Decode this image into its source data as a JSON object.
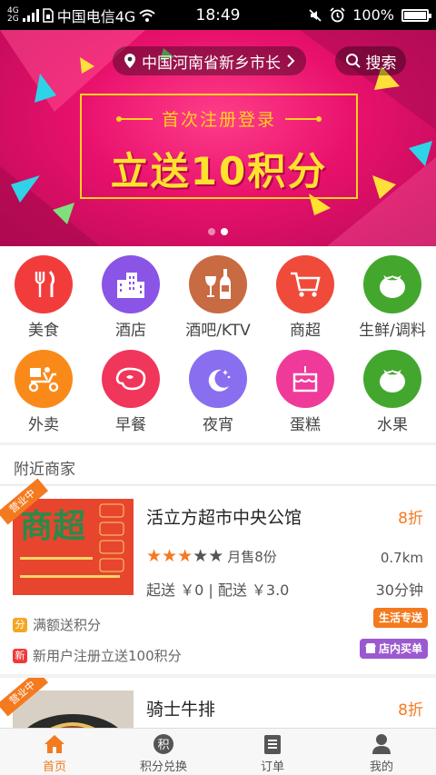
{
  "status_bar": {
    "carrier": "中国电信4G",
    "net_top": "4G",
    "net_bottom": "2G",
    "time": "18:49",
    "battery": "100%"
  },
  "banner": {
    "location": "中国河南省新乡市长",
    "search_label": "搜索",
    "promo_subtitle": "首次注册登录",
    "promo_title": "立送10积分",
    "slides_total": 2,
    "active_slide": 2
  },
  "categories": [
    {
      "label": "美食",
      "icon": "fork-knife-icon",
      "color": "#f23c3c"
    },
    {
      "label": "酒店",
      "icon": "hotel-building-icon",
      "color": "#8a54e6"
    },
    {
      "label": "酒吧/KTV",
      "icon": "wine-bottle-icon",
      "color": "#c86a42"
    },
    {
      "label": "商超",
      "icon": "shopping-cart-icon",
      "color": "#f04a3a"
    },
    {
      "label": "生鲜/调料",
      "icon": "tomato-icon",
      "color": "#43a72e"
    },
    {
      "label": "外卖",
      "icon": "delivery-scooter-icon",
      "color": "#f98a1a"
    },
    {
      "label": "早餐",
      "icon": "steak-icon",
      "color": "#f0365a"
    },
    {
      "label": "夜宵",
      "icon": "moon-icon",
      "color": "#8a6ef0"
    },
    {
      "label": "蛋糕",
      "icon": "cake-icon",
      "color": "#f03a9a"
    },
    {
      "label": "水果",
      "icon": "tomato-icon",
      "color": "#43a72e"
    }
  ],
  "nearby": {
    "title": "附近商家",
    "shops": [
      {
        "ribbon": "营业中",
        "thumb_title": "商超",
        "name": "活立方超市中央公馆",
        "discount": "8折",
        "rating": 3,
        "rating_max": 5,
        "sales": "月售8份",
        "distance": "0.7km",
        "fees": "起送 ￥0 | 配送 ￥3.0",
        "delivery_time": "30分钟",
        "promo1_badge": "分",
        "promo1": "满额送积分",
        "promo2_badge": "新",
        "promo2": "新用户注册立送100积分",
        "tag1": "生活专送",
        "tag2": "店内买单"
      },
      {
        "ribbon": "营业中",
        "name": "骑士牛排",
        "discount": "8折"
      }
    ]
  },
  "tabbar": {
    "tabs": [
      {
        "label": "首页",
        "icon": "home-icon"
      },
      {
        "label": "积分兑换",
        "icon": "points-icon"
      },
      {
        "label": "订单",
        "icon": "order-list-icon"
      },
      {
        "label": "我的",
        "icon": "user-icon"
      }
    ],
    "active_tab": "首页"
  },
  "colors": {
    "accent": "#f47a1f",
    "banner": "#e8116c",
    "promo_yellow": "#ffd21f"
  }
}
